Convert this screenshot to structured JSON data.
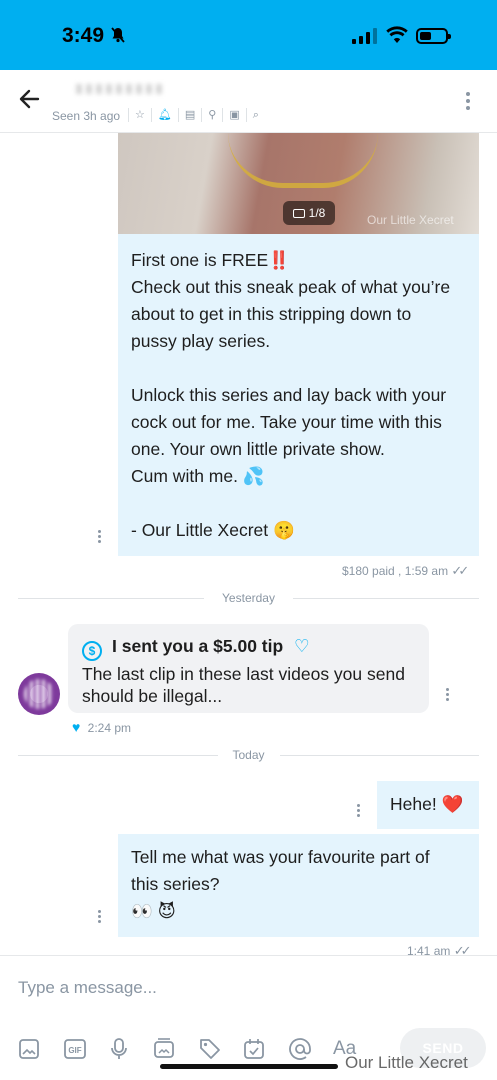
{
  "status_bar": {
    "time": "3:49"
  },
  "header": {
    "seen": "Seen 3h ago"
  },
  "media": {
    "counter": "1/8",
    "watermark": "Our Little Xecret"
  },
  "messages": {
    "m1": {
      "lines": [
        "First one is FREE‼️",
        "Check out this sneak peak of what you’re",
        "about to get in this stripping down to",
        "pussy play series.",
        "",
        "Unlock this series and lay back with your",
        "cock out for me. Take your time with this",
        "one. Your own little private show.",
        "Cum with me. 💦",
        "",
        "- Our Little Xecret 🤫"
      ],
      "meta": "$180 paid , 1:59 am"
    },
    "divider_yesterday": "Yesterday",
    "m2": {
      "tip_title": "I sent you a $5.00 tip",
      "text_lines": [
        "The last clip in these last videos you send",
        "should be illegal..."
      ],
      "time": "2:24 pm"
    },
    "divider_today": "Today",
    "m3": {
      "text": "Hehe! ❤️"
    },
    "m4": {
      "lines": [
        "Tell me what was your favourite part of",
        "this series?",
        "👀 😈"
      ],
      "meta": "1:41 am"
    }
  },
  "composer": {
    "placeholder": "Type a message...",
    "send_label": "SEND"
  },
  "watermark": "Our Little Xecret",
  "colors": {
    "brand": "#00aff0",
    "bubble_out": "#e4f4fd",
    "bubble_in": "#f1f2f4"
  }
}
